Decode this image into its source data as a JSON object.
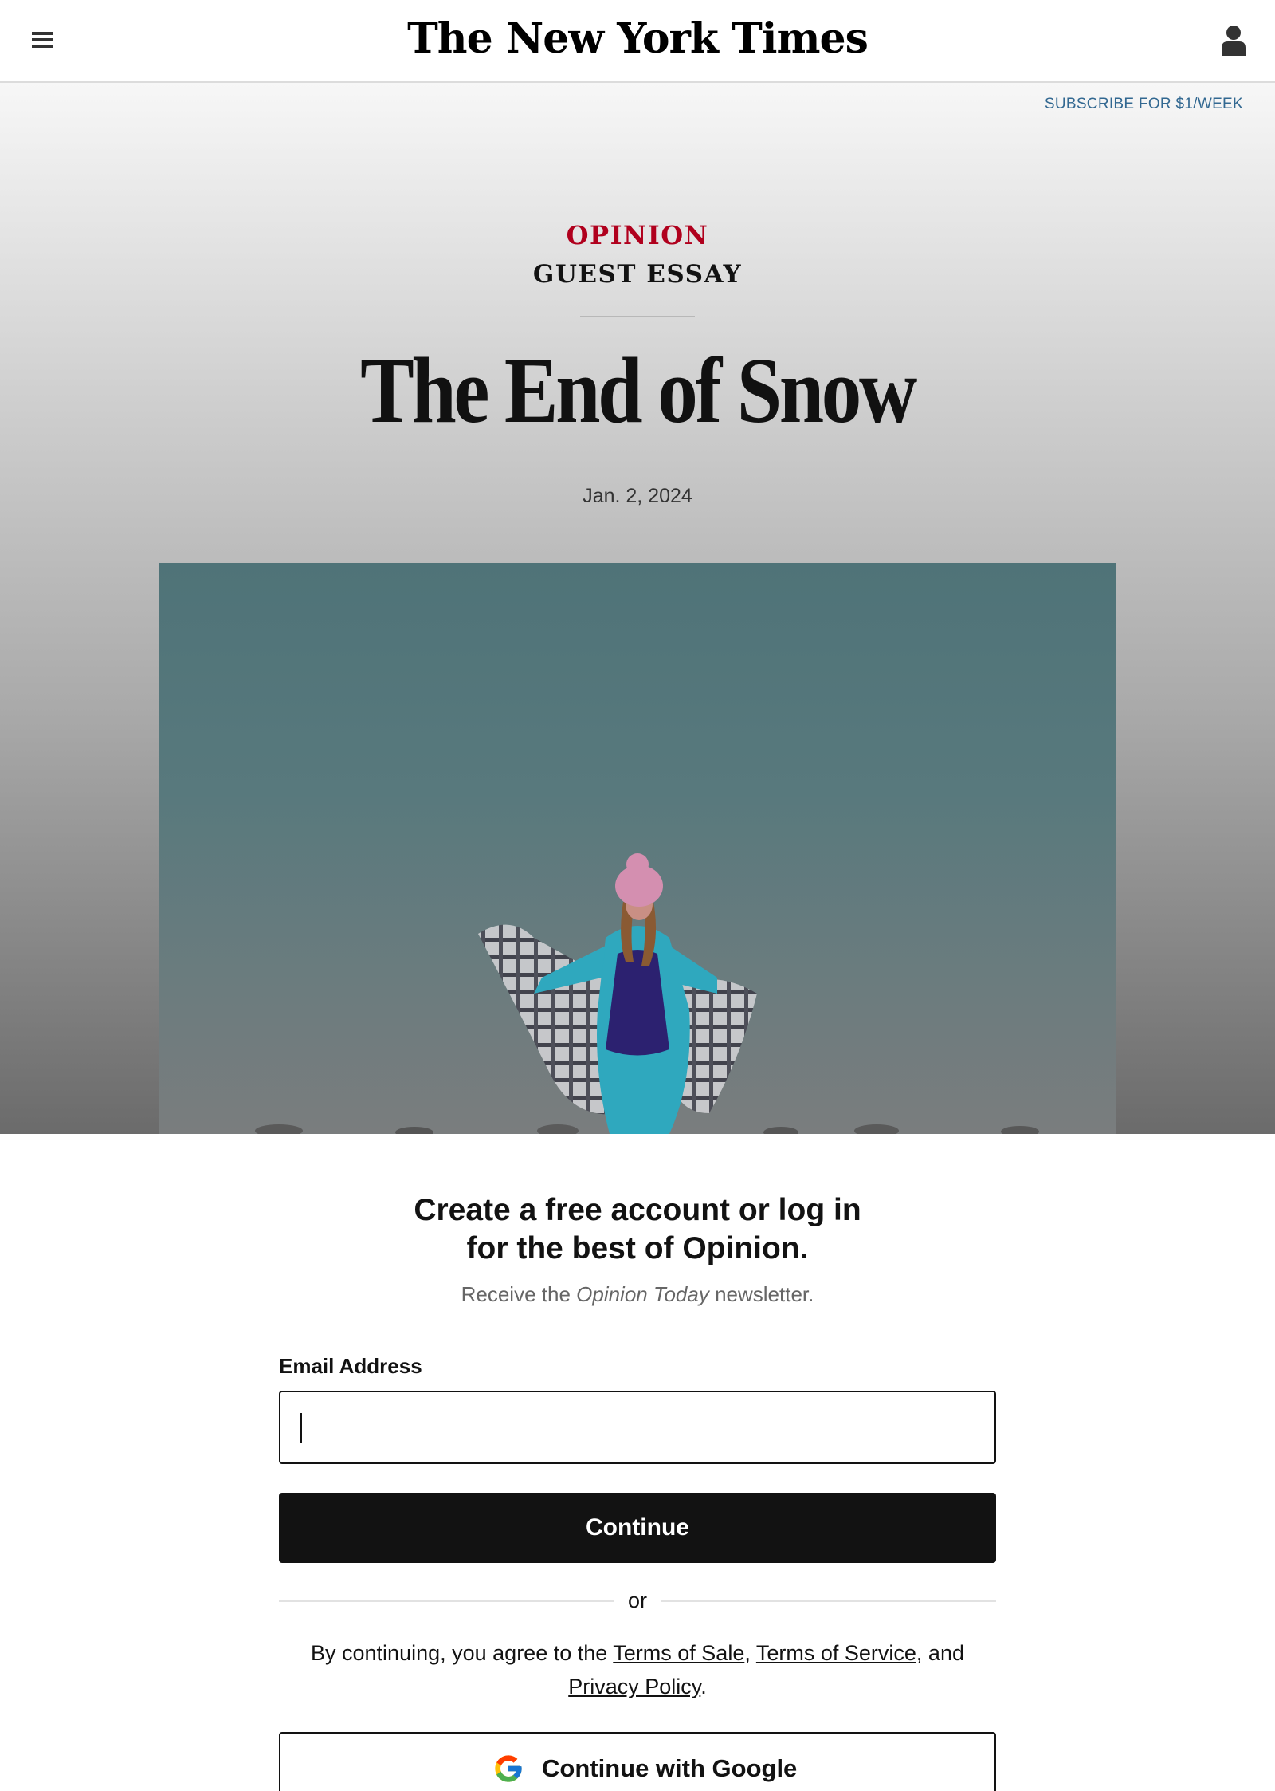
{
  "header": {
    "logo": "The New York Times",
    "menu_icon": "hamburger-menu-icon",
    "account_icon": "user-account-icon"
  },
  "hero": {
    "subscribe_link": "SUBSCRIBE FOR $1/WEEK",
    "kicker": "OPINION",
    "label": "GUEST ESSAY",
    "headline": "The End of Snow",
    "date": "Jan. 2, 2024"
  },
  "modal": {
    "title_line1": "Create a free account or log in",
    "title_line2": "for the best of Opinion.",
    "subtitle_prefix": "Receive the ",
    "subtitle_italic": "Opinion Today",
    "subtitle_suffix": " newsletter.",
    "email_label": "Email Address",
    "email_value": "",
    "continue_label": "Continue",
    "or_text": "or",
    "terms_prefix": "By continuing, you agree to the ",
    "terms_of_sale": "Terms of Sale",
    "terms_sep": ", ",
    "terms_of_service": "Terms of Service",
    "terms_and": ", and ",
    "privacy_policy": "Privacy Policy",
    "terms_end": ".",
    "google_label": "Continue with Google",
    "google_icon": "google-g-icon"
  },
  "colors": {
    "opinion_red": "#b0001d",
    "link_blue": "#326891",
    "button_black": "#121212"
  }
}
